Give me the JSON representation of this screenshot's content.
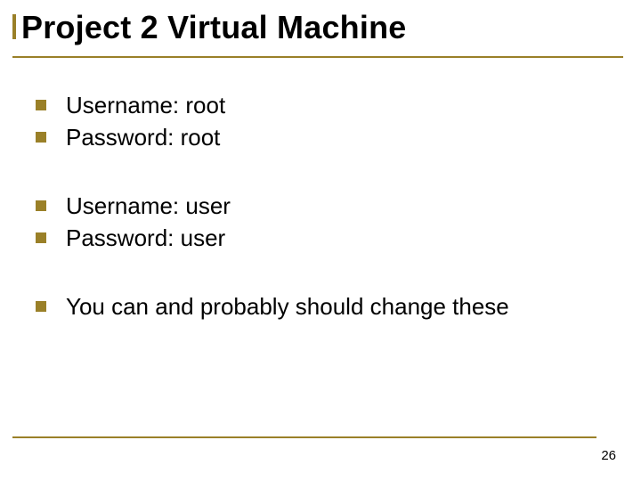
{
  "title": "Project 2 Virtual Machine",
  "groups": [
    {
      "items": [
        "Username: root",
        "Password: root"
      ]
    },
    {
      "items": [
        "Username: user",
        "Password: user"
      ]
    },
    {
      "items": [
        "You can and probably should change these"
      ]
    }
  ],
  "page_number": "26"
}
